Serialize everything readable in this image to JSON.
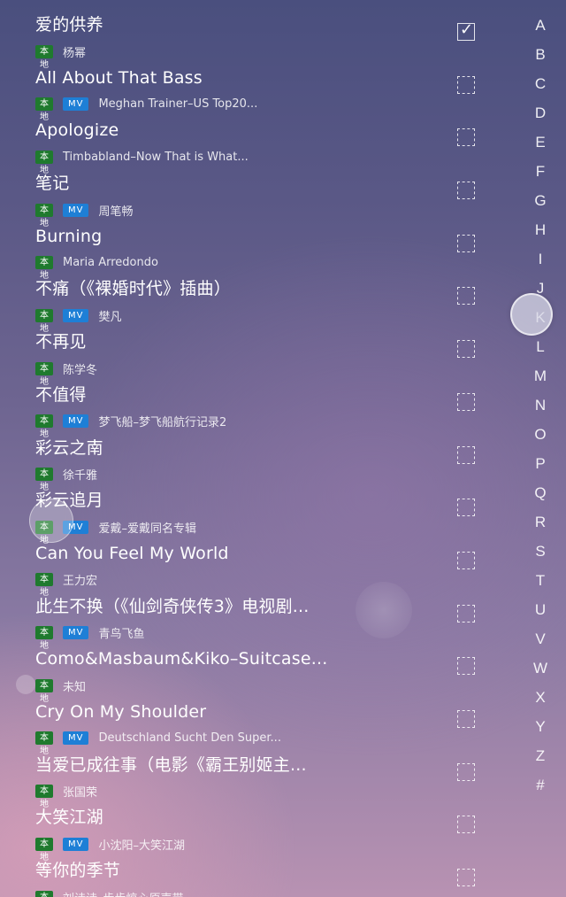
{
  "badges": {
    "local": "本地",
    "mv": "MV"
  },
  "songs": [
    {
      "title": "爱的供养",
      "artist": "杨幂",
      "mv": false,
      "checked": true
    },
    {
      "title": "All About That Bass",
      "artist": "Meghan Trainer–US Top20...",
      "mv": true,
      "checked": false
    },
    {
      "title": "Apologize",
      "artist": "Timbabland–Now That is What...",
      "mv": false,
      "checked": false
    },
    {
      "title": "笔记",
      "artist": "周笔畅",
      "mv": true,
      "checked": false
    },
    {
      "title": "Burning",
      "artist": "Maria Arredondo",
      "mv": false,
      "checked": false
    },
    {
      "title": "不痛（《裸婚时代》插曲）",
      "artist": "樊凡",
      "mv": true,
      "checked": false
    },
    {
      "title": "不再见",
      "artist": "陈学冬",
      "mv": false,
      "checked": false
    },
    {
      "title": "不值得",
      "artist": "梦飞船–梦飞船航行记录2",
      "mv": true,
      "checked": false
    },
    {
      "title": "彩云之南",
      "artist": "徐千雅",
      "mv": false,
      "checked": false
    },
    {
      "title": "彩云追月",
      "artist": "爱戴–爱戴同名专辑",
      "mv": true,
      "checked": false
    },
    {
      "title": "Can You Feel My World",
      "artist": "王力宏",
      "mv": false,
      "checked": false
    },
    {
      "title": "此生不换（《仙剑奇侠传3》电视剧...",
      "artist": "青鸟飞鱼",
      "mv": true,
      "checked": false
    },
    {
      "title": "Como&Masbaum&Kiko–Suitcase...",
      "artist": "未知",
      "mv": false,
      "checked": false
    },
    {
      "title": "Cry On My Shoulder",
      "artist": "Deutschland Sucht Den Super...",
      "mv": true,
      "checked": false
    },
    {
      "title": "当爱已成往事（电影《霸王别姬主...",
      "artist": "张国荣",
      "mv": false,
      "checked": false
    },
    {
      "title": "大笑江湖",
      "artist": "小沈阳–大笑江湖",
      "mv": true,
      "checked": false
    },
    {
      "title": "等你的季节",
      "artist": "刘诗诗–步步惊心原声带",
      "mv": false,
      "checked": false
    }
  ],
  "index_letters": [
    "A",
    "B",
    "C",
    "D",
    "E",
    "F",
    "G",
    "H",
    "I",
    "J",
    "K",
    "L",
    "M",
    "N",
    "O",
    "P",
    "Q",
    "R",
    "S",
    "T",
    "U",
    "V",
    "W",
    "X",
    "Y",
    "Z",
    "#"
  ],
  "active_index": "K"
}
